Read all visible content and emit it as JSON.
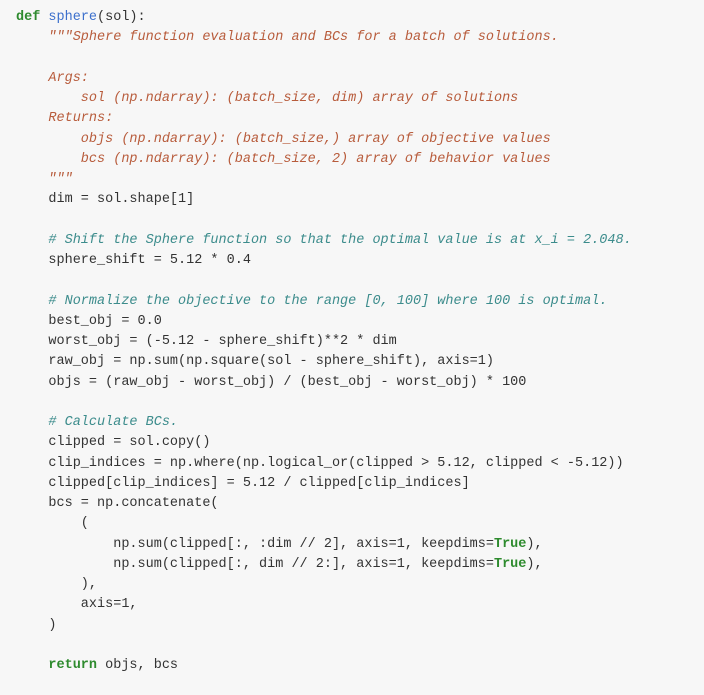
{
  "code": {
    "l1_def": "def",
    "l1_fn": "sphere",
    "l1_rest": "(sol):",
    "l2": "    \"\"\"Sphere function evaluation and BCs for a batch of solutions.",
    "l3": "",
    "l4": "    Args:",
    "l5": "        sol (np.ndarray): (batch_size, dim) array of solutions",
    "l6": "    Returns:",
    "l7": "        objs (np.ndarray): (batch_size,) array of objective values",
    "l8": "        bcs (np.ndarray): (batch_size, 2) array of behavior values",
    "l9": "    \"\"\"",
    "l10": "    dim = sol.shape[1]",
    "l11": "",
    "l12": "    # Shift the Sphere function so that the optimal value is at x_i = 2.048.",
    "l13": "    sphere_shift = 5.12 * 0.4",
    "l14": "",
    "l15": "    # Normalize the objective to the range [0, 100] where 100 is optimal.",
    "l16": "    best_obj = 0.0",
    "l17": "    worst_obj = (-5.12 - sphere_shift)**2 * dim",
    "l18": "    raw_obj = np.sum(np.square(sol - sphere_shift), axis=1)",
    "l19": "    objs = (raw_obj - worst_obj) / (best_obj - worst_obj) * 100",
    "l20": "",
    "l21": "    # Calculate BCs.",
    "l22": "    clipped = sol.copy()",
    "l23": "    clip_indices = np.where(np.logical_or(clipped > 5.12, clipped < -5.12))",
    "l24": "    clipped[clip_indices] = 5.12 / clipped[clip_indices]",
    "l25": "    bcs = np.concatenate(",
    "l26": "        (",
    "l27_a": "            np.sum(clipped[:, :dim // 2], axis=1, keepdims=",
    "l27_b": "True",
    "l27_c": "),",
    "l28_a": "            np.sum(clipped[:, dim // 2:], axis=1, keepdims=",
    "l28_b": "True",
    "l28_c": "),",
    "l29": "        ),",
    "l30": "        axis=1,",
    "l31": "    )",
    "l32": "",
    "l33_a": "    ",
    "l33_b": "return",
    "l33_c": " objs, bcs"
  }
}
